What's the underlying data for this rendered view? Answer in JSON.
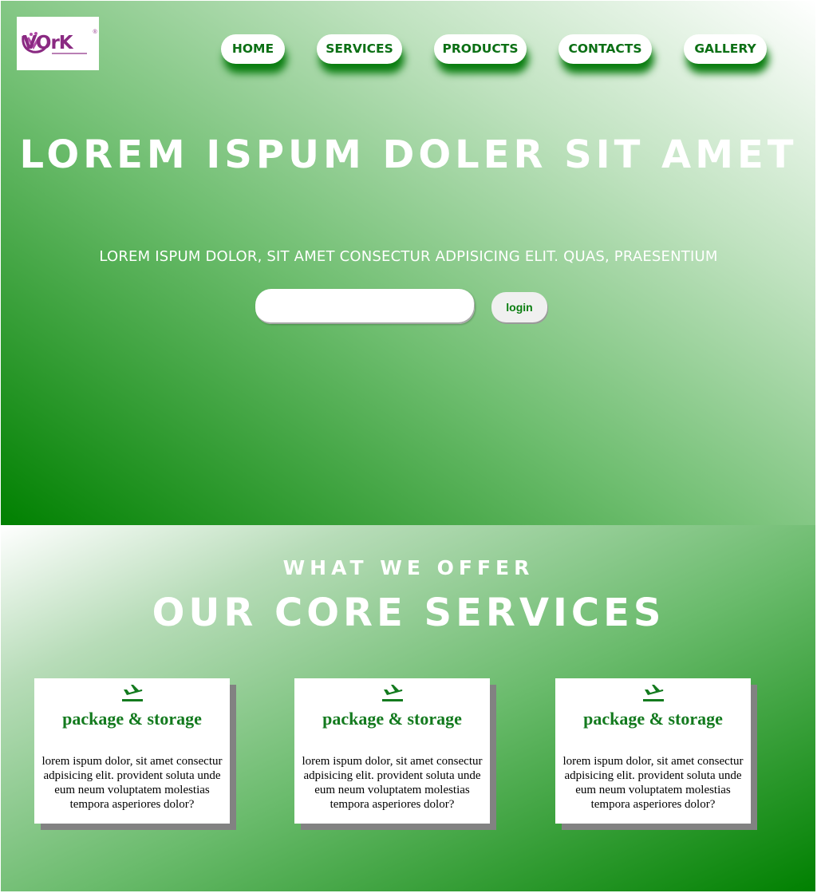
{
  "logo": {
    "text": "VOrK",
    "tm": "®"
  },
  "nav": {
    "items": [
      {
        "label": "HOME"
      },
      {
        "label": "SERVICES"
      },
      {
        "label": "PRODUCTS"
      },
      {
        "label": "CONTACTS"
      },
      {
        "label": "GALLERY"
      }
    ]
  },
  "hero": {
    "title": "LOREM ISPUM DOLER SIT AMET",
    "subtitle": "LOREM ISPUM DOLOR, SIT AMET CONSECTUR ADPISICING ELIT. QUAS, PRAESENTIUM",
    "search_value": "",
    "search_placeholder": "",
    "login_label": "login"
  },
  "services": {
    "kicker": "WHAT WE OFFER",
    "title": "OUR CORE SERVICES",
    "cards": [
      {
        "icon": "airplane-icon",
        "title": "package & storage",
        "text": "lorem ispum dolor, sit amet consectur adpisicing elit. provident soluta unde eum neum voluptatem molestias tempora asperiores dolor?"
      },
      {
        "icon": "airplane-icon",
        "title": "package & storage",
        "text": "lorem ispum dolor, sit amet consectur adpisicing elit. provident soluta unde eum neum voluptatem molestias tempora asperiores dolor?"
      },
      {
        "icon": "airplane-icon",
        "title": "package & storage",
        "text": "lorem ispum dolor, sit amet consectur adpisicing elit. provident soluta unde eum neum voluptatem molestias tempora asperiores dolor?"
      }
    ]
  },
  "colors": {
    "brand_green": "#008000",
    "nav_text": "#0b6f14",
    "card_title": "#137a1e",
    "logo_purple": "#8a2a82"
  }
}
